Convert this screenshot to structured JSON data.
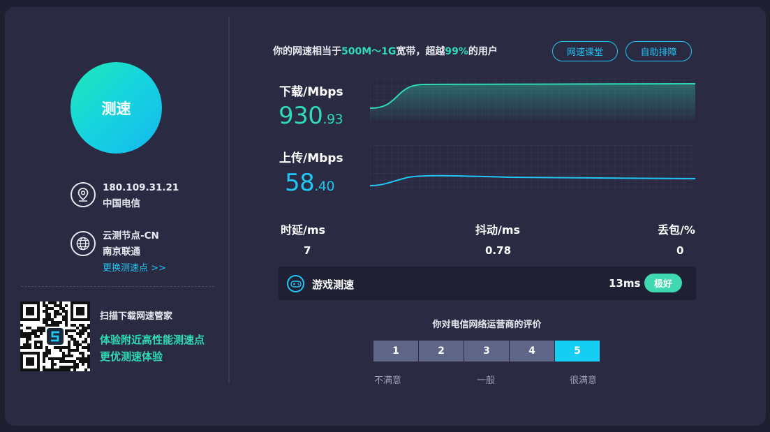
{
  "left": {
    "speed_button": "测速",
    "ip": "180.109.31.21",
    "isp": "中国电信",
    "node_name": "云测节点-CN",
    "node_isp": "南京联通",
    "change_node": "更换测速点 >>",
    "qr_title": "扫描下载网速管家",
    "qr_line1": "体验附近高性能测速点",
    "qr_line2": "更优测速体验"
  },
  "headline": {
    "part1": "你的网速相当于",
    "bandwidth": "500M～1G",
    "part2": "宽带，超越",
    "percent": "99%",
    "part3": "的用户"
  },
  "buttons": {
    "course": "网速课堂",
    "troubleshoot": "自助排障"
  },
  "download": {
    "label": "下载/Mbps",
    "int": "930",
    "dec": ".93",
    "color": "#2fd9b4"
  },
  "upload": {
    "label": "上传/Mbps",
    "int": "58",
    "dec": ".40",
    "color": "#21c4f2"
  },
  "stats": {
    "latency_label": "时延/ms",
    "latency": "7",
    "jitter_label": "抖动/ms",
    "jitter": "0.78",
    "loss_label": "丢包/%",
    "loss": "0"
  },
  "game": {
    "label": "游戏测速",
    "value": "13ms",
    "badge": "极好"
  },
  "rating": {
    "title": "你对电信网络运营商的评价",
    "options": [
      "1",
      "2",
      "3",
      "4",
      "5"
    ],
    "selected": "5",
    "low": "不满意",
    "mid": "一般",
    "high": "很满意"
  }
}
